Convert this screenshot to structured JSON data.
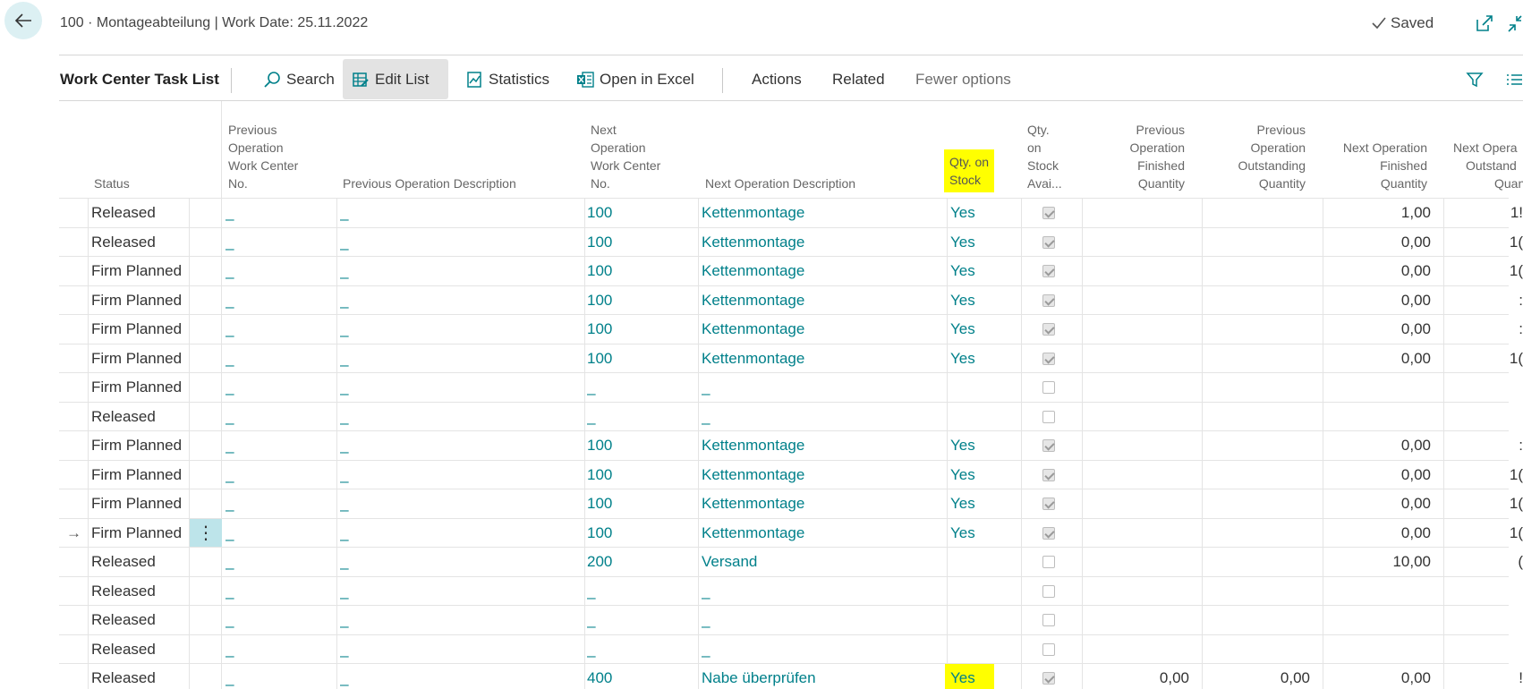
{
  "header": {
    "caption": "100 · Montageabteilung | Work Date: 25.11.2022",
    "saved_label": "Saved"
  },
  "actionbar": {
    "title": "Work Center Task List",
    "search_label": "Search",
    "edit_list_label": "Edit List",
    "statistics_label": "Statistics",
    "open_excel_label": "Open in Excel",
    "actions_label": "Actions",
    "related_label": "Related",
    "fewer_options_label": "Fewer options"
  },
  "columns": {
    "status": "Status",
    "prev_wc": [
      "Previous",
      "Operation",
      "Work Center",
      "No."
    ],
    "prev_desc": "Previous Operation Description",
    "next_wc": [
      "Next",
      "Operation",
      "Work Center",
      "No."
    ],
    "next_desc": "Next Operation Description",
    "qty_on_stock": [
      "Qty. on",
      "Stock"
    ],
    "qty_avail": [
      "Qty.",
      "on",
      "Stock",
      "Avai..."
    ],
    "prev_fin": [
      "Previous",
      "Operation",
      "Finished",
      "Quantity"
    ],
    "prev_out": [
      "Previous",
      "Operation",
      "Outstanding",
      "Quantity"
    ],
    "next_fin": [
      "Next Operation",
      "Finished",
      "Quantity"
    ],
    "next_out": [
      "Next Opera",
      "Outstand",
      "Quan"
    ]
  },
  "rows": [
    {
      "status": "Released",
      "prev_wc": "_",
      "prev_desc": "_",
      "next_wc": "100",
      "next_desc": "Kettenmontage",
      "qty_on_stock": "Yes",
      "avail": true,
      "prev_fin": "",
      "prev_out": "",
      "next_fin": "1,00",
      "next_out": "1!"
    },
    {
      "status": "Released",
      "prev_wc": "_",
      "prev_desc": "_",
      "next_wc": "100",
      "next_desc": "Kettenmontage",
      "qty_on_stock": "Yes",
      "avail": true,
      "prev_fin": "",
      "prev_out": "",
      "next_fin": "0,00",
      "next_out": "1("
    },
    {
      "status": "Firm Planned",
      "prev_wc": "_",
      "prev_desc": "_",
      "next_wc": "100",
      "next_desc": "Kettenmontage",
      "qty_on_stock": "Yes",
      "avail": true,
      "prev_fin": "",
      "prev_out": "",
      "next_fin": "0,00",
      "next_out": "1("
    },
    {
      "status": "Firm Planned",
      "prev_wc": "_",
      "prev_desc": "_",
      "next_wc": "100",
      "next_desc": "Kettenmontage",
      "qty_on_stock": "Yes",
      "avail": true,
      "prev_fin": "",
      "prev_out": "",
      "next_fin": "0,00",
      "next_out": ":"
    },
    {
      "status": "Firm Planned",
      "prev_wc": "_",
      "prev_desc": "_",
      "next_wc": "100",
      "next_desc": "Kettenmontage",
      "qty_on_stock": "Yes",
      "avail": true,
      "prev_fin": "",
      "prev_out": "",
      "next_fin": "0,00",
      "next_out": ":"
    },
    {
      "status": "Firm Planned",
      "prev_wc": "_",
      "prev_desc": "_",
      "next_wc": "100",
      "next_desc": "Kettenmontage",
      "qty_on_stock": "Yes",
      "avail": true,
      "prev_fin": "",
      "prev_out": "",
      "next_fin": "0,00",
      "next_out": "1("
    },
    {
      "status": "Firm Planned",
      "prev_wc": "_",
      "prev_desc": "_",
      "next_wc": "_",
      "next_desc": "_",
      "qty_on_stock": "",
      "avail": false,
      "prev_fin": "",
      "prev_out": "",
      "next_fin": "",
      "next_out": ""
    },
    {
      "status": "Released",
      "prev_wc": "_",
      "prev_desc": "_",
      "next_wc": "_",
      "next_desc": "_",
      "qty_on_stock": "",
      "avail": false,
      "prev_fin": "",
      "prev_out": "",
      "next_fin": "",
      "next_out": ""
    },
    {
      "status": "Firm Planned",
      "prev_wc": "_",
      "prev_desc": "_",
      "next_wc": "100",
      "next_desc": "Kettenmontage",
      "qty_on_stock": "Yes",
      "avail": true,
      "prev_fin": "",
      "prev_out": "",
      "next_fin": "0,00",
      "next_out": ":"
    },
    {
      "status": "Firm Planned",
      "prev_wc": "_",
      "prev_desc": "_",
      "next_wc": "100",
      "next_desc": "Kettenmontage",
      "qty_on_stock": "Yes",
      "avail": true,
      "prev_fin": "",
      "prev_out": "",
      "next_fin": "0,00",
      "next_out": "1("
    },
    {
      "status": "Firm Planned",
      "prev_wc": "_",
      "prev_desc": "_",
      "next_wc": "100",
      "next_desc": "Kettenmontage",
      "qty_on_stock": "Yes",
      "avail": true,
      "prev_fin": "",
      "prev_out": "",
      "next_fin": "0,00",
      "next_out": "1("
    },
    {
      "status": "Firm Planned",
      "prev_wc": "_",
      "prev_desc": "_",
      "next_wc": "100",
      "next_desc": "Kettenmontage",
      "qty_on_stock": "Yes",
      "avail": true,
      "prev_fin": "",
      "prev_out": "",
      "next_fin": "0,00",
      "next_out": "1(",
      "selected": true
    },
    {
      "status": "Released",
      "prev_wc": "_",
      "prev_desc": "_",
      "next_wc": "200",
      "next_desc": "Versand",
      "qty_on_stock": "",
      "avail": false,
      "prev_fin": "",
      "prev_out": "",
      "next_fin": "10,00",
      "next_out": "("
    },
    {
      "status": "Released",
      "prev_wc": "_",
      "prev_desc": "_",
      "next_wc": "_",
      "next_desc": "_",
      "qty_on_stock": "",
      "avail": false,
      "prev_fin": "",
      "prev_out": "",
      "next_fin": "",
      "next_out": ""
    },
    {
      "status": "Released",
      "prev_wc": "_",
      "prev_desc": "_",
      "next_wc": "_",
      "next_desc": "_",
      "qty_on_stock": "",
      "avail": false,
      "prev_fin": "",
      "prev_out": "",
      "next_fin": "",
      "next_out": ""
    },
    {
      "status": "Released",
      "prev_wc": "_",
      "prev_desc": "_",
      "next_wc": "_",
      "next_desc": "_",
      "qty_on_stock": "",
      "avail": false,
      "prev_fin": "",
      "prev_out": "",
      "next_fin": "",
      "next_out": ""
    },
    {
      "status": "Released",
      "prev_wc": "_",
      "prev_desc": "_",
      "next_wc": "400",
      "next_desc": "Nabe überprüfen",
      "qty_on_stock": "Yes",
      "qty_on_stock_highlight": true,
      "avail": true,
      "prev_fin": "0,00",
      "prev_out": "0,00",
      "next_fin": "0,00",
      "next_out": "!"
    }
  ],
  "colors": {
    "accent": "#00808a",
    "highlight": "#ffff00",
    "back_button_bg": "#dcf0f3",
    "selected_menu_bg": "#bde4ea"
  },
  "icons": {
    "back": "arrow-left-icon",
    "saved": "checkmark-icon",
    "open_new_window": "open-in-new-window-icon",
    "collapse": "collapse-icon",
    "search": "search-icon",
    "edit_list": "edit-list-icon",
    "statistics": "statistics-icon",
    "excel": "excel-icon",
    "filter": "filter-icon",
    "list_view": "list-view-icon",
    "row_menu": "vertical-ellipsis-icon",
    "row_arrow": "arrow-right-icon"
  }
}
